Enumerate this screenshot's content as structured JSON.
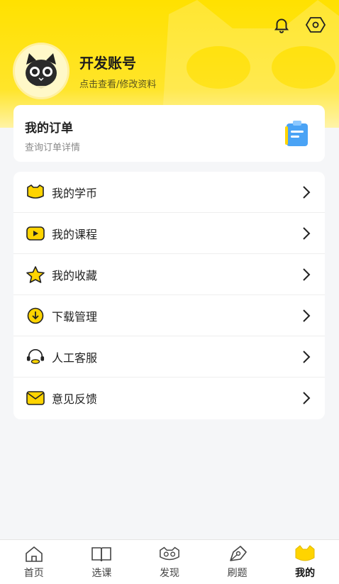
{
  "profile": {
    "name": "开发账号",
    "subtitle": "点击查看/修改资料"
  },
  "header_icons": [
    "bell-icon",
    "settings-hex-icon"
  ],
  "order": {
    "title": "我的订单",
    "subtitle": "查询订单详情"
  },
  "menu": {
    "items": [
      {
        "label": "我的学币",
        "icon": "coin-icon"
      },
      {
        "label": "我的课程",
        "icon": "play-icon"
      },
      {
        "label": "我的收藏",
        "icon": "star-icon"
      },
      {
        "label": "下载管理",
        "icon": "download-icon"
      },
      {
        "label": "人工客服",
        "icon": "headset-icon"
      },
      {
        "label": "意见反馈",
        "icon": "mail-icon"
      }
    ]
  },
  "tabs": [
    {
      "label": "首页",
      "icon": "home-icon"
    },
    {
      "label": "选课",
      "icon": "book-icon"
    },
    {
      "label": "发现",
      "icon": "mask-icon"
    },
    {
      "label": "刷题",
      "icon": "pen-icon"
    },
    {
      "label": "我的",
      "icon": "cat-icon",
      "active": true
    }
  ],
  "colors": {
    "brand_yellow": "#ffe100",
    "background": "#f5f6f8",
    "card": "#ffffff"
  }
}
